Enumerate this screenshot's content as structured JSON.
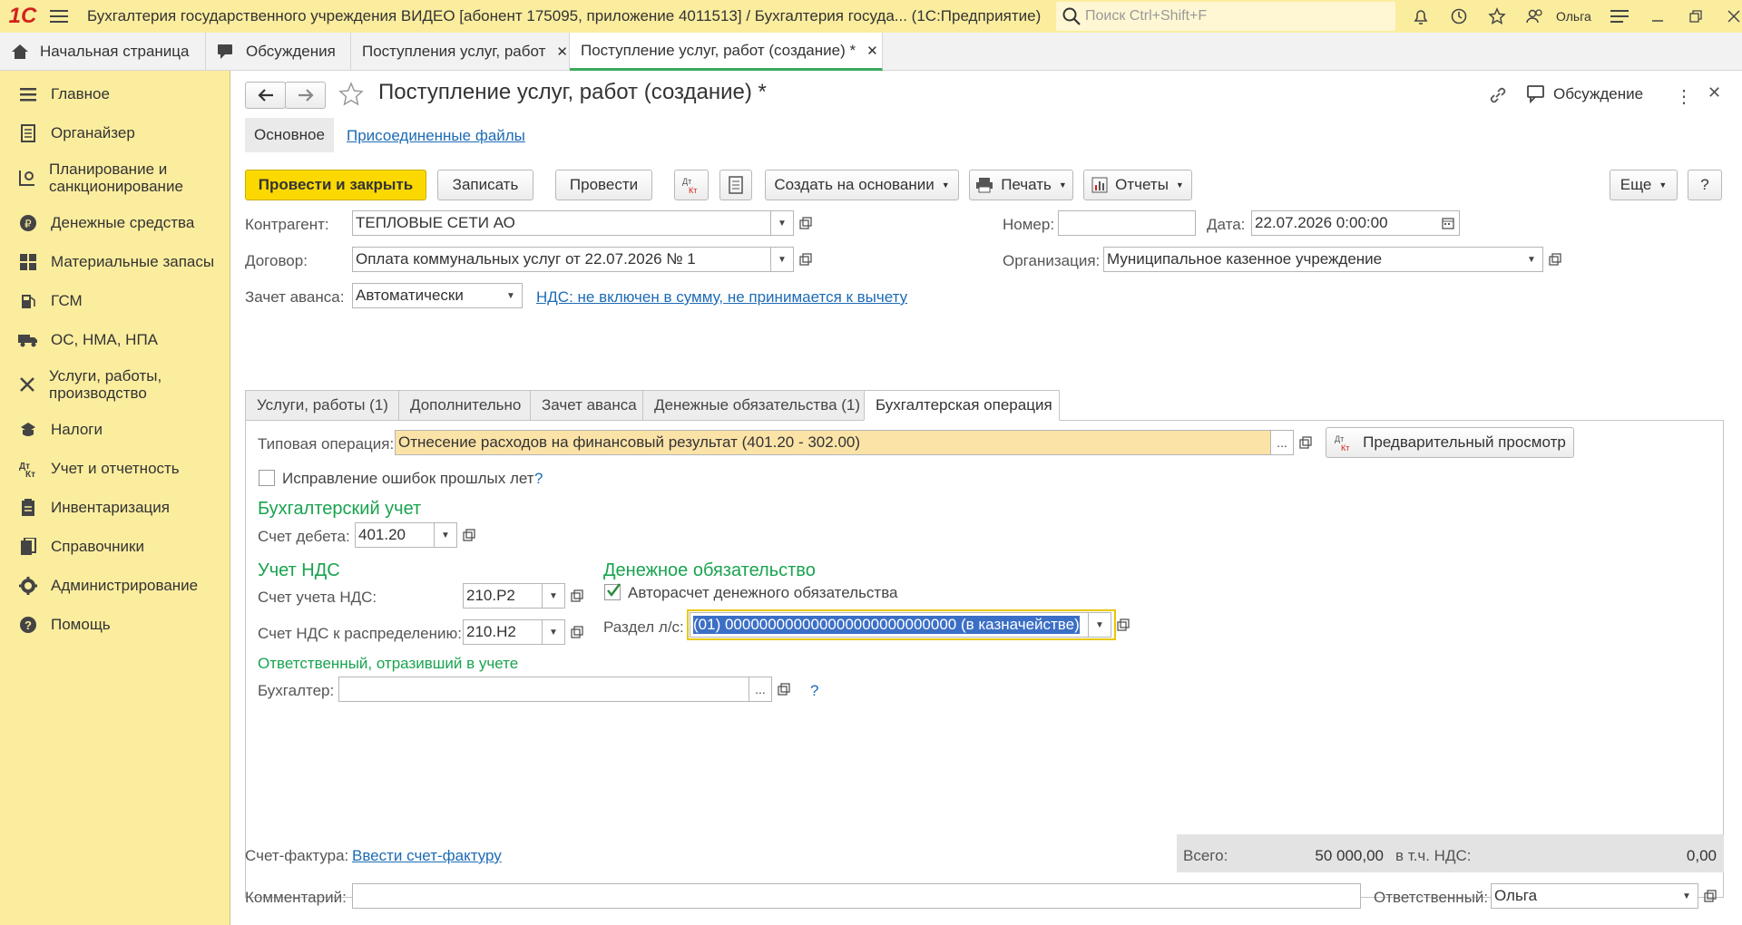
{
  "app": {
    "title": "Бухгалтерия государственного учреждения ВИДЕО [абонент 175095, приложение 4011513] / Бухгалтерия госуда...  (1С:Предприятие)",
    "search_placeholder": "Поиск Ctrl+Shift+F",
    "user": "Ольга",
    "logo": "1С"
  },
  "tabs": [
    {
      "label": "Начальная страница"
    },
    {
      "label": "Обсуждения"
    },
    {
      "label": "Поступления услуг, работ"
    },
    {
      "label": "Поступление услуг, работ (создание) *"
    }
  ],
  "sidebar": {
    "items": [
      {
        "label": "Главное",
        "icon": "menu-icon"
      },
      {
        "label": "Органайзер",
        "icon": "organizer-icon"
      },
      {
        "label": "Планирование и санкционирование",
        "icon": "planning-icon"
      },
      {
        "label": "Денежные средства",
        "icon": "money-icon"
      },
      {
        "label": "Материальные запасы",
        "icon": "grid-icon"
      },
      {
        "label": "ГСМ",
        "icon": "fuel-icon"
      },
      {
        "label": "ОС, НМА, НПА",
        "icon": "truck-icon"
      },
      {
        "label": "Услуги, работы, производство",
        "icon": "tools-icon"
      },
      {
        "label": "Налоги",
        "icon": "tax-icon"
      },
      {
        "label": "Учет и отчетность",
        "icon": "accounting-icon"
      },
      {
        "label": "Инвентаризация",
        "icon": "inventory-icon"
      },
      {
        "label": "Справочники",
        "icon": "books-icon"
      },
      {
        "label": "Администрирование",
        "icon": "gear-icon"
      },
      {
        "label": "Помощь",
        "icon": "help-icon"
      }
    ]
  },
  "form": {
    "title": "Поступление услуг, работ (создание) *",
    "discussion": "Обсуждение",
    "subtabs": {
      "main": "Основное",
      "files": "Присоединенные файлы"
    },
    "toolbar": {
      "post_close": "Провести и закрыть",
      "save": "Записать",
      "post": "Провести",
      "dtkt": "Дт Кт",
      "create_based": "Создать на основании",
      "print": "Печать",
      "reports": "Отчеты",
      "more": "Еще",
      "help": "?"
    },
    "fields": {
      "counterparty_label": "Контрагент:",
      "counterparty": "ТЕПЛОВЫЕ СЕТИ АО",
      "number_label": "Номер:",
      "number": "",
      "date_label": "Дата:",
      "date": "22.07.2026  0:00:00",
      "contract_label": "Договор:",
      "contract": "Оплата коммунальных услуг от 22.07.2026 № 1",
      "org_label": "Организация:",
      "org": "Муниципальное казенное учреждение",
      "advance_label": "Зачет аванса:",
      "advance": "Автоматически",
      "vat_link": "НДС: не включен в сумму, не принимается к вычету"
    },
    "tabs": [
      "Услуги, работы (1)",
      "Дополнительно",
      "Зачет аванса",
      "Денежные обязательства (1)",
      "Бухгалтерская операция"
    ],
    "op": {
      "typical_label": "Типовая операция:",
      "typical": "Отнесение расходов на финансовый результат (401.20 - 302.00)",
      "preview": "Предварительный просмотр",
      "fix_errors": "Исправление ошибок прошлых лет",
      "acc_header": "Бухгалтерский учет",
      "debit_label": "Счет дебета:",
      "debit": "401.20",
      "vat_header": "Учет НДС",
      "vat_acc_label": "Счет учета НДС:",
      "vat_acc": "210.Р2",
      "vat_dist_label": "Счет НДС к распределению:",
      "vat_dist": "210.Н2",
      "money_header": "Денежное обязательство",
      "autocalc": "Авторасчет денежного обязательства",
      "section_label": "Раздел л/с:",
      "section": "(01) 000000000000000000000000000 (в казначействе)",
      "resp_header": "Ответственный, отразивший в учете",
      "accountant_label": "Бухгалтер:",
      "accountant": ""
    },
    "footer": {
      "invoice_label": "Счет-фактура:",
      "invoice_link": "Ввести счет-фактуру",
      "total_label": "Всего:",
      "total": "50 000,00",
      "vat_label": "в т.ч. НДС:",
      "vat": "0,00",
      "comment_label": "Комментарий:",
      "comment": "",
      "resp_label": "Ответственный:",
      "resp": "Ольга"
    }
  }
}
